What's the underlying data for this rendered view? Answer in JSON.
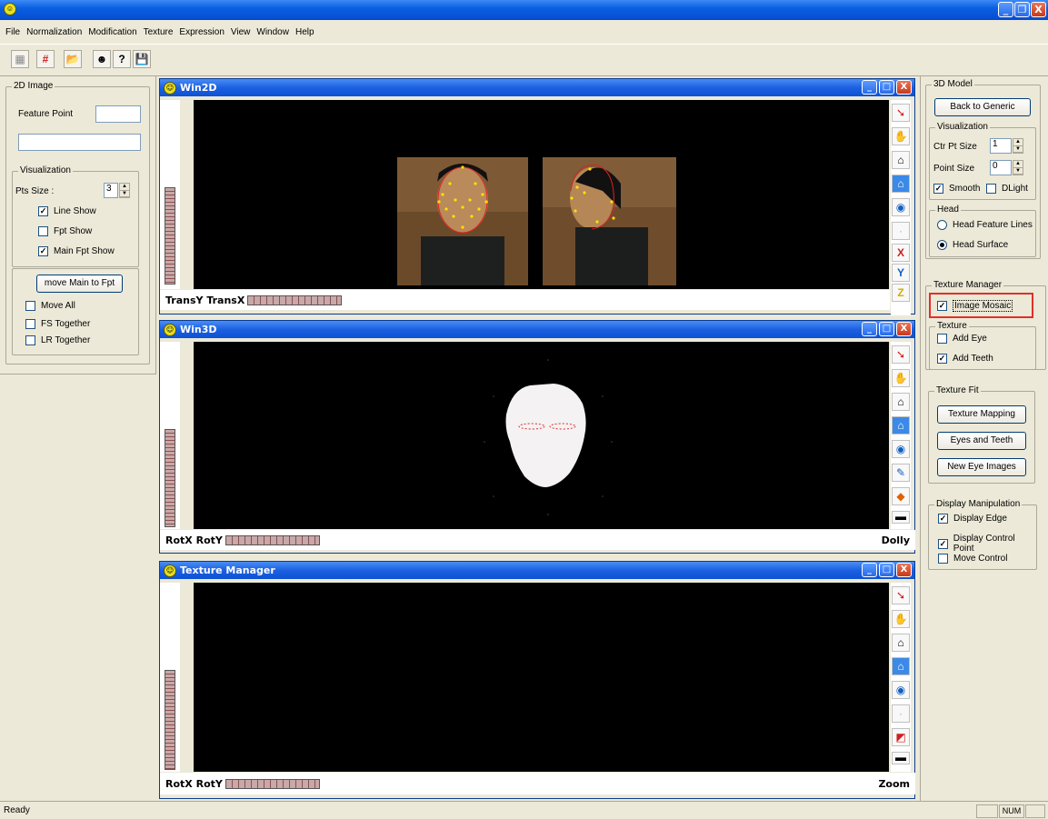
{
  "menu": [
    "File",
    "Normalization",
    "Modification",
    "Texture",
    "Expression",
    "View",
    "Window",
    "Help"
  ],
  "window_buttons": {
    "minimize": "_",
    "restore": "❐",
    "close": "X"
  },
  "left_panel": {
    "group_title": "2D Image",
    "feature_point_label": "Feature Point",
    "feature_point_value": "",
    "text_field_value": "",
    "visualization_title": "Visualization",
    "pts_size_label": "Pts Size :",
    "pts_size_value": "3",
    "checks": [
      {
        "label": "Line Show",
        "checked": true
      },
      {
        "label": "Fpt Show",
        "checked": false
      },
      {
        "label": "Main Fpt Show",
        "checked": true
      }
    ],
    "move_button": "move Main to Fpt",
    "move_checks": [
      {
        "label": "Move All",
        "checked": false
      },
      {
        "label": "FS Together",
        "checked": false
      },
      {
        "label": "LR Together",
        "checked": false
      }
    ]
  },
  "win2d": {
    "title": "Win2D",
    "bottom_label": "TransY TransX",
    "right_label": ""
  },
  "win3d": {
    "title": "Win3D",
    "bottom_label": "RotX RotY",
    "right_label": "Dolly"
  },
  "wintex": {
    "title": "Texture Manager",
    "bottom_label": "RotX RotY",
    "right_label": "Zoom"
  },
  "right_panel": {
    "model_title": "3D Model",
    "back_button": "Back to Generic",
    "vis_title": "Visualization",
    "ctr_pt_label": "Ctr Pt Size",
    "ctr_pt_value": "1",
    "point_size_label": "Point Size",
    "point_size_value": "0",
    "smooth_label": "Smooth",
    "smooth_checked": true,
    "dlight_label": "DLight",
    "dlight_checked": false,
    "head_title": "Head",
    "head_options": [
      {
        "label": "Head Feature Lines",
        "selected": false
      },
      {
        "label": "Head Surface",
        "selected": true
      }
    ],
    "tex_mgr_title": "Texture Manager",
    "image_mosaic_label": "Image Mosaic",
    "image_mosaic_checked": true,
    "texture_title": "Texture",
    "add_eye_label": "Add Eye",
    "add_eye_checked": false,
    "add_teeth_label": "Add Teeth",
    "add_teeth_checked": true,
    "tex_fit_title": "Texture Fit",
    "tex_fit_buttons": [
      "Texture Mapping",
      "Eyes and Teeth",
      "New Eye Images"
    ],
    "display_title": "Display Manipulation",
    "display_checks": [
      {
        "label": "Display Edge",
        "checked": true
      },
      {
        "label": "Display Control Point",
        "checked": true
      },
      {
        "label": "Move Control",
        "checked": false
      }
    ]
  },
  "status": {
    "text": "Ready",
    "num": "NUM"
  },
  "colors": {
    "highlight": "#e0302a",
    "title_blue": "#0a5fe0"
  }
}
